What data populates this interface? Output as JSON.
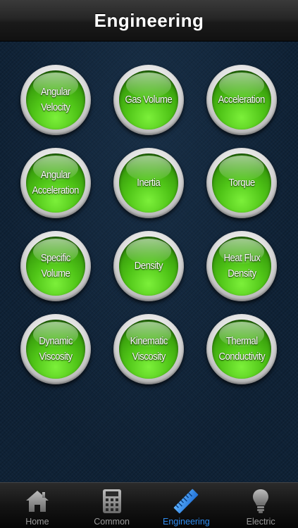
{
  "header": {
    "title": "Engineering"
  },
  "buttons": [
    {
      "label": "Angular\nVelocity"
    },
    {
      "label": "Gas Volume"
    },
    {
      "label": "Acceleration"
    },
    {
      "label": "Angular\nAcceleration"
    },
    {
      "label": "Inertia"
    },
    {
      "label": "Torque"
    },
    {
      "label": "Specific\nVolume"
    },
    {
      "label": "Density"
    },
    {
      "label": "Heat Flux\nDensity"
    },
    {
      "label": "Dynamic\nViscosity"
    },
    {
      "label": "Kinematic\nViscosity"
    },
    {
      "label": "Thermal\nConductivity"
    }
  ],
  "tabs": [
    {
      "label": "Home",
      "icon": "house-icon",
      "active": false
    },
    {
      "label": "Common",
      "icon": "calculator-icon",
      "active": false
    },
    {
      "label": "Engineering",
      "icon": "ruler-icon",
      "active": true
    },
    {
      "label": "Electric",
      "icon": "lightbulb-icon",
      "active": false
    }
  ],
  "colors": {
    "button_green": "#4fc417",
    "tab_active": "#2f8cf0",
    "tab_inactive": "#9a9a9a",
    "background": "#0f2236"
  }
}
